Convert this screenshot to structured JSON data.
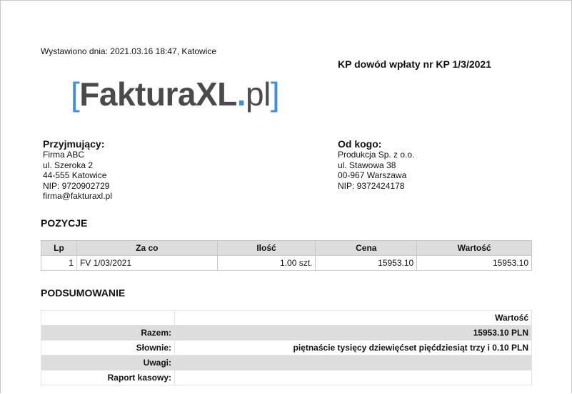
{
  "issued": "Wystawiono dnia: 2021.03.16 18:47, Katowice",
  "doc_title": "KP dowód wpłaty nr KP 1/3/2021",
  "logo": {
    "bracket_left": "[",
    "main": "FakturaXL",
    "dot": ".",
    "tld": "pl",
    "bracket_right": "]"
  },
  "receiver": {
    "heading": "Przyjmujący:",
    "lines": [
      "Firma ABC",
      "ul. Szeroka 2",
      "44-555 Katowice",
      "NIP: 9720902729",
      "firma@fakturaxl.pl"
    ]
  },
  "payer": {
    "heading": "Od kogo:",
    "lines": [
      "Produkcja Sp. z o.o.",
      "ul. Stawowa 38",
      "00-967 Warszawa",
      "NIP: 9372424178"
    ]
  },
  "positions": {
    "title": "POZYCJE",
    "headers": [
      "Lp",
      "Za co",
      "Ilość",
      "Cena",
      "Wartość"
    ],
    "rows": [
      {
        "lp": "1",
        "za_co": "FV 1/03/2021",
        "ilosc": "1.00 szt.",
        "cena": "15953.10",
        "wartosc": "15953.10"
      }
    ]
  },
  "summary": {
    "title": "PODSUMOWANIE",
    "value_header": "Wartość",
    "rows": [
      {
        "label": "Razem:",
        "value": "15953.10 PLN"
      },
      {
        "label": "Słownie:",
        "value": "piętnaście tysięcy dziewięćset pięćdziesiąt trzy i 0.10 PLN"
      },
      {
        "label": "Uwagi:",
        "value": ""
      },
      {
        "label": "Raport kasowy:",
        "value": ""
      }
    ]
  },
  "colors": {
    "logo_accent": "#3b8ee0",
    "logo_text": "#4a4a4a",
    "table_header_bg": "#dddddd"
  }
}
